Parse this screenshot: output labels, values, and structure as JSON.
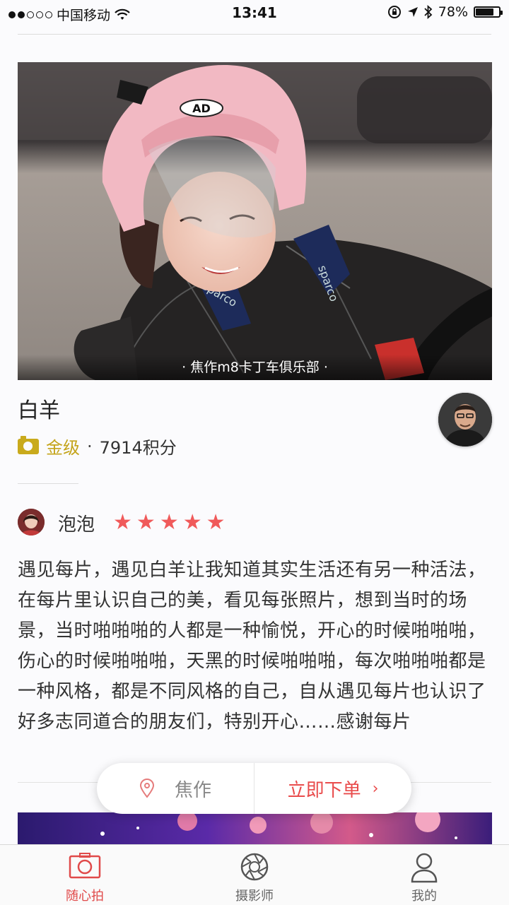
{
  "status_bar": {
    "carrier": "中国移动",
    "time": "13:41",
    "battery": "78%",
    "battery_level": 0.78
  },
  "hero": {
    "caption": "· 焦作m8卡丁车俱乐部 ·",
    "helmet_text": "AD",
    "suit_text": "sparco"
  },
  "photographer": {
    "name": "白羊",
    "level": "金级",
    "separator": "·",
    "points": "7914积分"
  },
  "review": {
    "user": "泡泡",
    "rating": 5,
    "stars": [
      "★",
      "★",
      "★",
      "★",
      "★"
    ],
    "text": "遇见每片，遇见白羊让我知道其实生活还有另一种活法，在每片里认识自己的美，看见每张照片，想到当时的场景，当时啪啪啪的人都是一种愉悦，开心的时候啪啪啪，伤心的时候啪啪啪，天黑的时候啪啪啪，每次啪啪啪都是一种风格，都是不同风格的自己，自从遇见每片也认识了好多志同道合的朋友们，特别开心……感谢每片"
  },
  "action_bar": {
    "location": "焦作",
    "location_icon": "location-pin-icon",
    "order": "立即下单",
    "order_icon": "chevron-right-icon"
  },
  "tabs": [
    {
      "label": "随心拍",
      "icon": "camera-icon",
      "active": true
    },
    {
      "label": "摄影师",
      "icon": "aperture-icon",
      "active": false
    },
    {
      "label": "我的",
      "icon": "person-icon",
      "active": false
    }
  ],
  "colors": {
    "accent": "#e04a4a",
    "star": "#f05a5a",
    "gold": "#c4a41a"
  }
}
